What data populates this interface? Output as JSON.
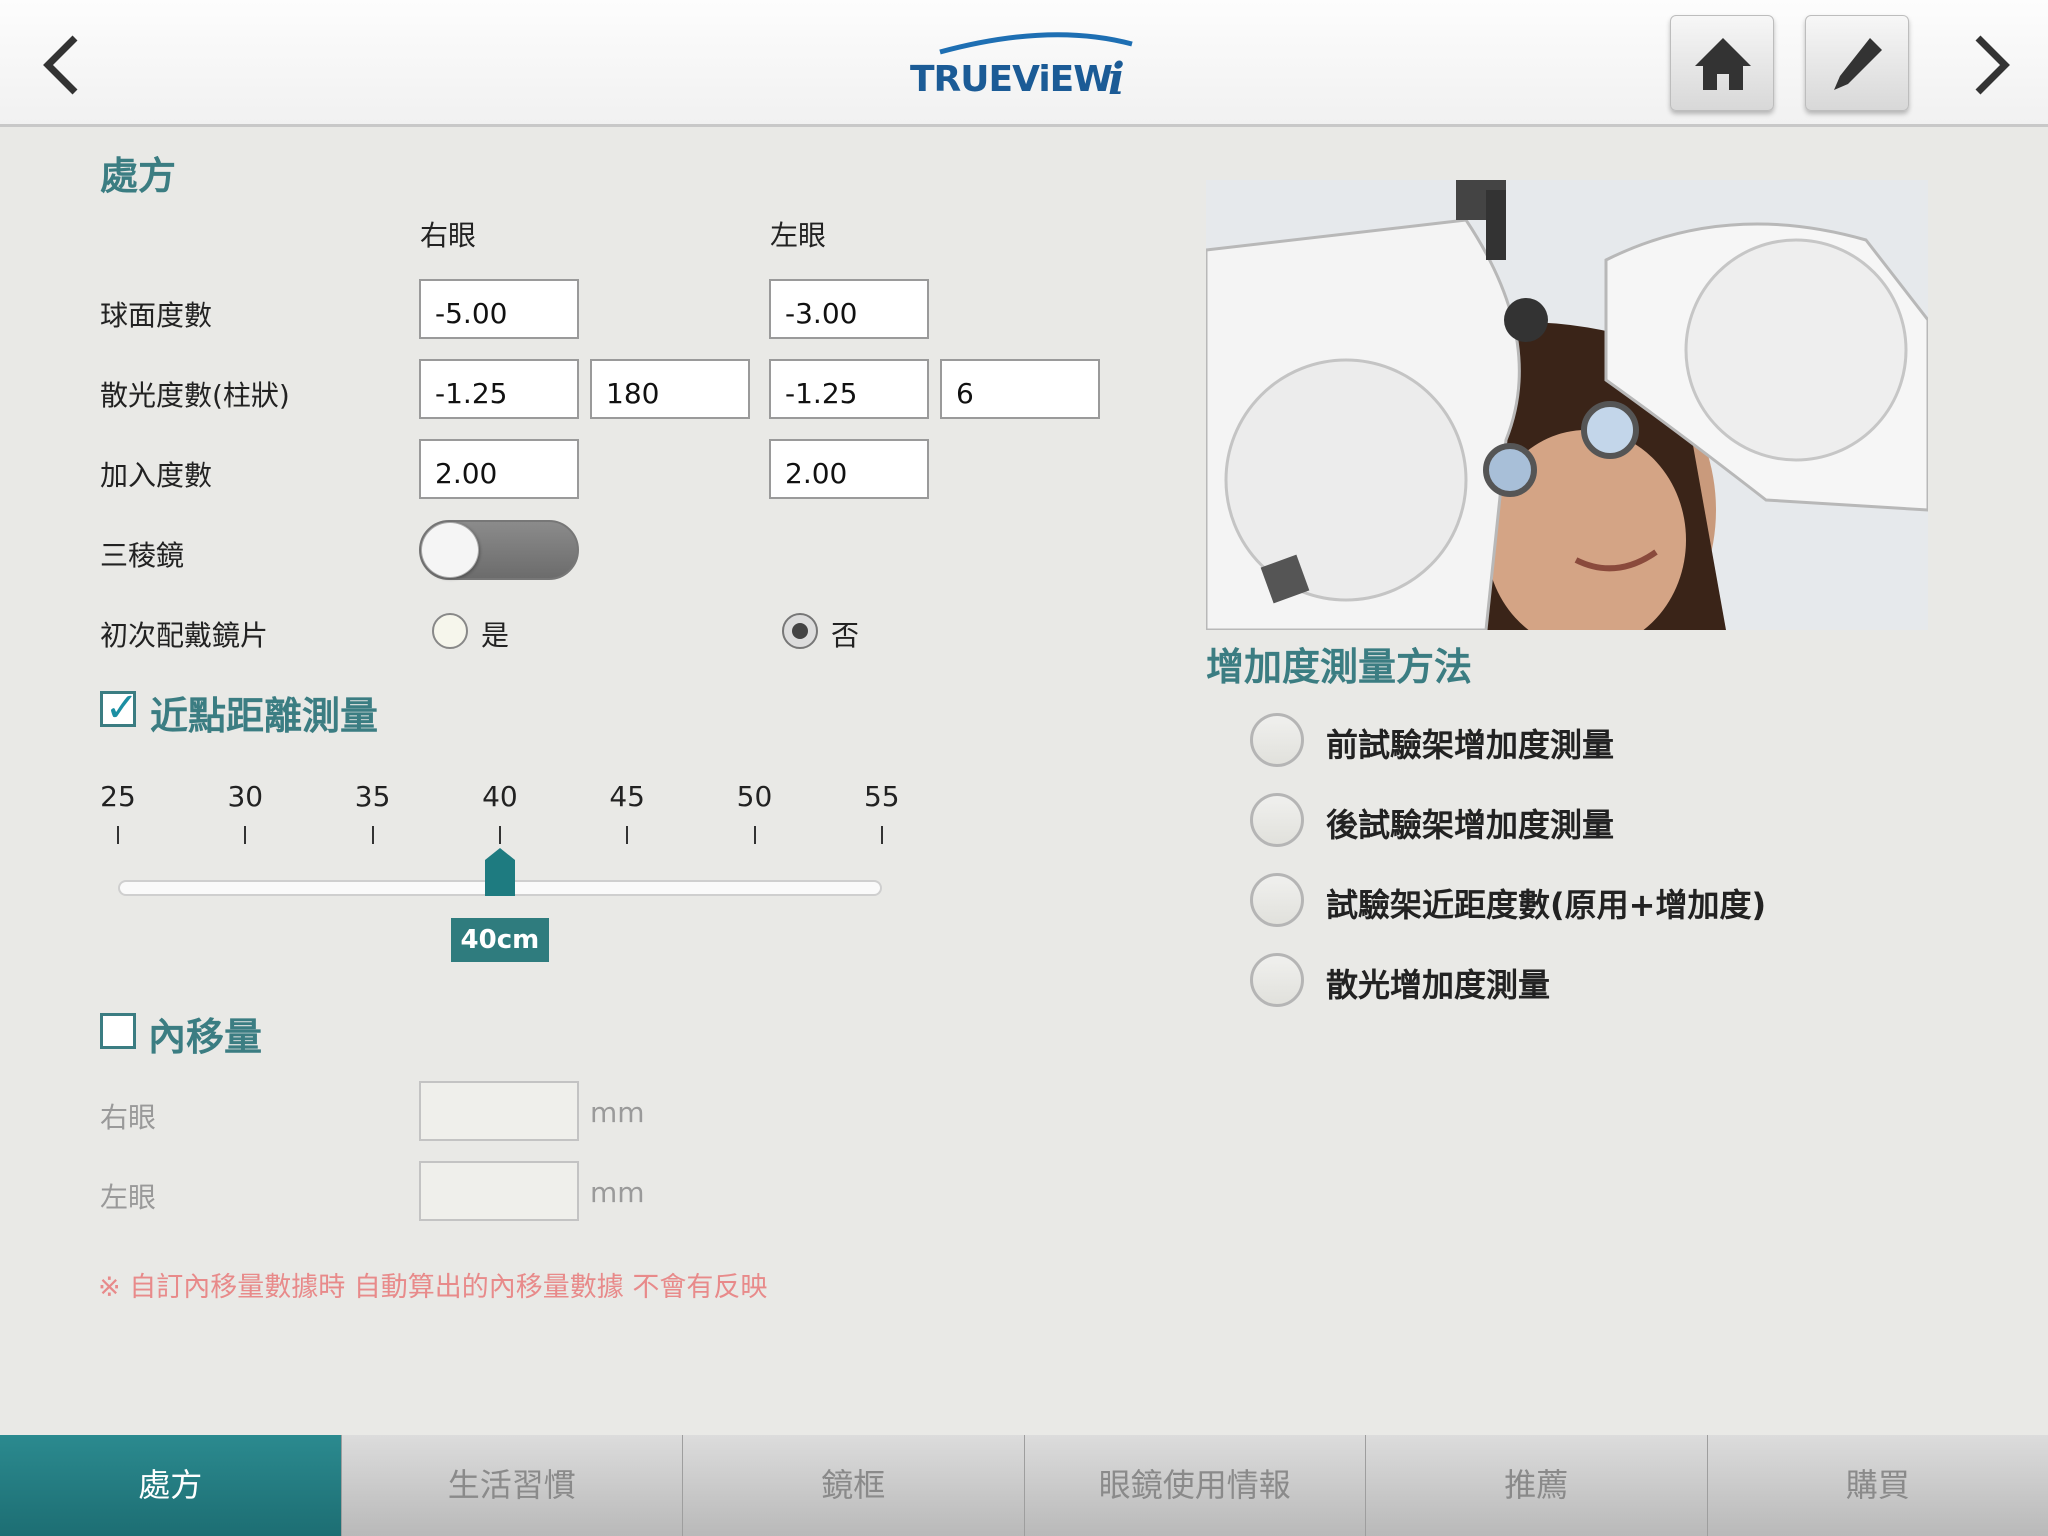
{
  "header": {
    "logo_text": "TRUEViEW",
    "logo_mark": "i"
  },
  "prescription": {
    "title": "處方",
    "right_eye_label": "右眼",
    "left_eye_label": "左眼",
    "rows": {
      "sphere": {
        "label": "球面度數",
        "right": "-5.00",
        "left": "-3.00"
      },
      "cylinder": {
        "label": "散光度數(柱狀)",
        "right": "-1.25",
        "right_axis": "180",
        "left": "-1.25",
        "left_axis": "6"
      },
      "add": {
        "label": "加入度數",
        "right": "2.00",
        "left": "2.00"
      },
      "prism": {
        "label": "三稜鏡",
        "state": "off"
      },
      "first_time": {
        "label": "初次配戴鏡片",
        "yes": "是",
        "no": "否",
        "selected": "否"
      }
    }
  },
  "near_distance": {
    "title": "近點距離測量",
    "checked": true,
    "ticks": [
      "25",
      "30",
      "35",
      "40",
      "45",
      "50",
      "55"
    ],
    "value": 40,
    "value_label": "40cm"
  },
  "inset": {
    "title": "內移量",
    "checked": false,
    "right_label": "右眼",
    "left_label": "左眼",
    "unit": "mm",
    "right_value": "",
    "left_value": ""
  },
  "note": "※ 自訂內移量數據時 自動算出的內移量數據 不會有反映",
  "method": {
    "title": "增加度測量方法",
    "options": [
      "前試驗架增加度測量",
      "後試驗架增加度測量",
      "試驗架近距度數(原用+增加度)",
      "散光增加度測量"
    ]
  },
  "tabs": [
    "處方",
    "生活習慣",
    "鏡框",
    "眼鏡使用情報",
    "推薦",
    "購買"
  ],
  "active_tab": "處方",
  "colors": {
    "accent": "#3b7d82",
    "tab_active": "#1d6e73",
    "note": "#e88a8a"
  }
}
